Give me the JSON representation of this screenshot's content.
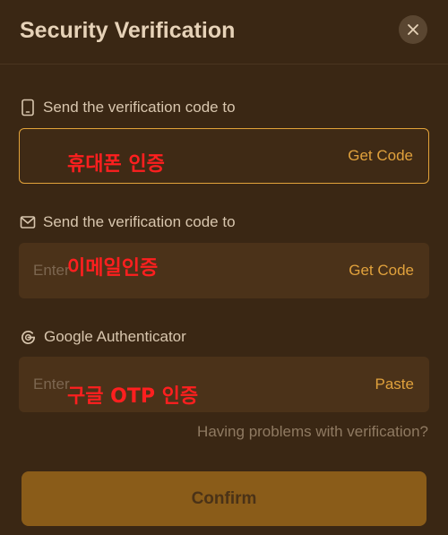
{
  "dialog": {
    "title": "Security Verification"
  },
  "phone": {
    "label": "Send the verification code to",
    "placeholder": "",
    "action": "Get Code",
    "annotation": "휴대폰 인증"
  },
  "email": {
    "label": "Send the verification code to",
    "placeholder": "Enter",
    "action": "Get Code",
    "annotation": "이메일인증"
  },
  "google": {
    "label": "Google Authenticator",
    "placeholder": "Enter",
    "action": "Paste",
    "annotation": "구글 OTP 인증"
  },
  "footer": {
    "problems_link": "Having problems with verification?",
    "confirm_label": "Confirm"
  },
  "colors": {
    "background": "#3a2714",
    "accent": "#e0a13c",
    "annotation": "#ff1f1f"
  },
  "icons": {
    "close": "close-icon",
    "phone": "phone-icon",
    "email": "mail-icon",
    "google": "google-icon"
  }
}
